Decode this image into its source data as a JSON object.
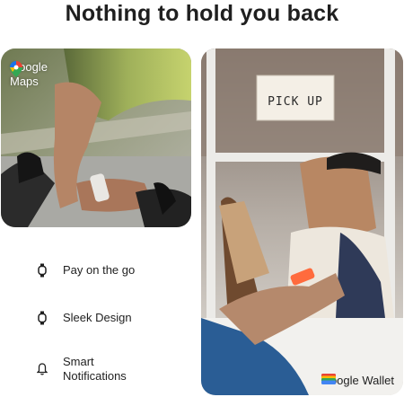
{
  "headline": "Nothing to hold you back",
  "left_card": {
    "badge_label": "Google\nMaps",
    "badge_icon": "google-maps-pin-icon"
  },
  "features": [
    {
      "icon": "watch-icon",
      "label": "Pay on the go"
    },
    {
      "icon": "watch-icon",
      "label": "Sleek Design"
    },
    {
      "icon": "bell-icon",
      "label": "Smart Notifications"
    }
  ],
  "right_card": {
    "sign_text": "PICK UP",
    "badge_label": "Google Wallet",
    "badge_icon": "google-wallet-icon"
  },
  "colors": {
    "text": "#1f1f1f",
    "cyclist_jersey": "#9fb05a",
    "wallet_band": "#ff6b3d",
    "booth_frame": "#e9e7e3"
  }
}
